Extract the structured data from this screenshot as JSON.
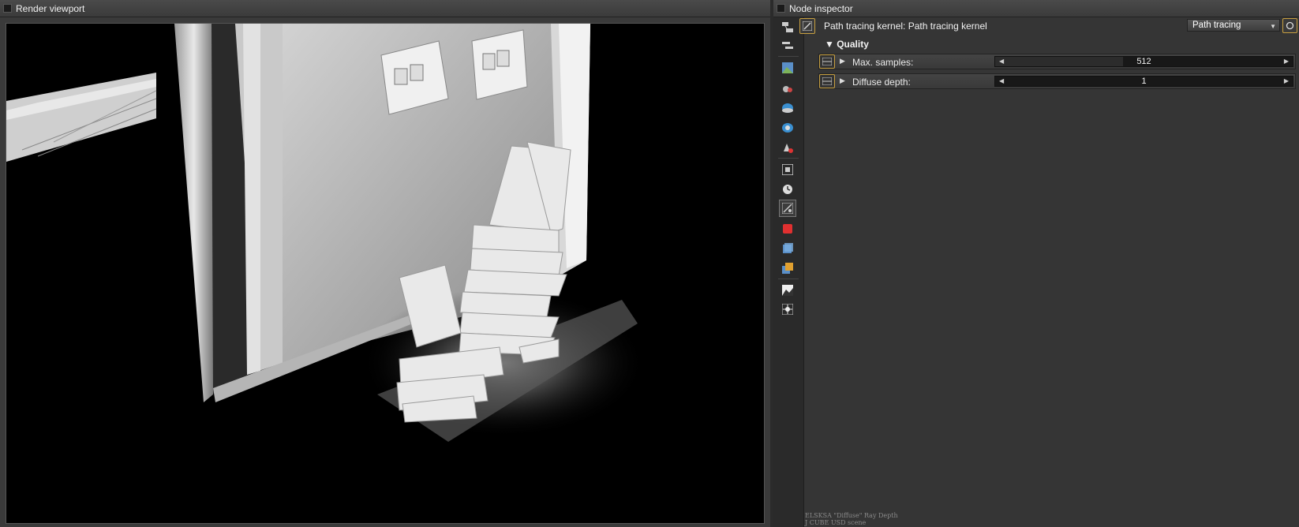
{
  "viewport": {
    "title": "Render viewport"
  },
  "inspector": {
    "title": "Node inspector",
    "node_title": "Path tracing kernel: Path tracing kernel",
    "kernel_type": "Path tracing",
    "section": "Quality",
    "params": [
      {
        "label": "Max. samples:",
        "value": "512",
        "fill_fraction": 0.43
      },
      {
        "label": "Diffuse depth:",
        "value": "1",
        "fill_fraction": 0.0
      }
    ],
    "status_lines": [
      "ELSKSA \"Diffuse\" Ray Depth",
      "J CUBE USD scene"
    ]
  },
  "toolbar": {
    "icons": [
      "node-graph-icon",
      "outliner-icon",
      "image-icon",
      "camera-settings-icon",
      "environment-icon",
      "visible-environment-icon",
      "material-icon",
      "film-settings-icon",
      "animation-icon",
      "kernel-icon",
      "geometry-icon",
      "object-layer-icon",
      "render-layer-icon",
      "imager-icon",
      "post-process-icon"
    ],
    "active": "kernel-icon"
  }
}
